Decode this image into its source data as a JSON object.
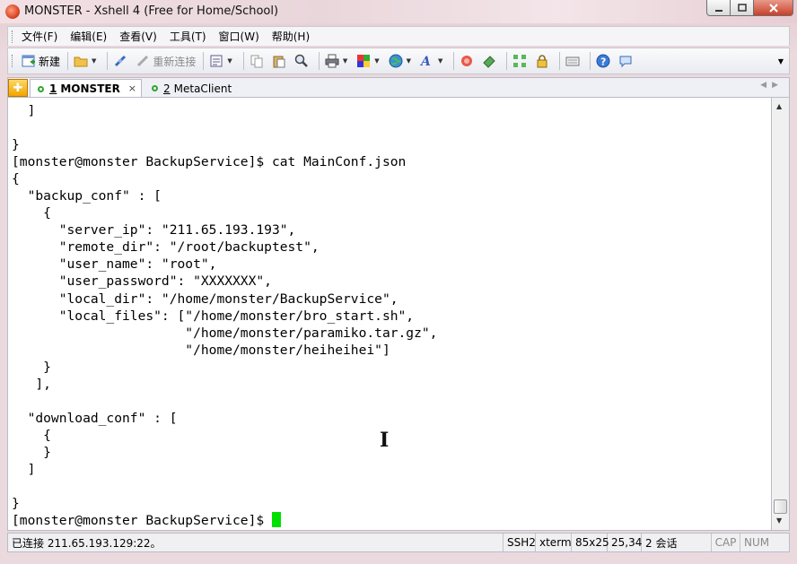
{
  "window": {
    "title": "MONSTER - Xshell 4 (Free for Home/School)"
  },
  "menu": {
    "items": [
      "文件(F)",
      "编辑(E)",
      "查看(V)",
      "工具(T)",
      "窗口(W)",
      "帮助(H)"
    ]
  },
  "toolbar": {
    "new_label": "新建",
    "reconnect_label": "重新连接"
  },
  "tabs": [
    {
      "number": "1",
      "label": "MONSTER",
      "active": true
    },
    {
      "number": "2",
      "label": "MetaClient",
      "active": false
    }
  ],
  "terminal": {
    "lines": [
      "  ]",
      "",
      "}",
      "[monster@monster BackupService]$ cat MainConf.json",
      "{",
      "  \"backup_conf\" : [",
      "    {",
      "      \"server_ip\": \"211.65.193.193\",",
      "      \"remote_dir\": \"/root/backuptest\",",
      "      \"user_name\": \"root\",",
      "      \"user_password\": \"XXXXXXX\",",
      "      \"local_dir\": \"/home/monster/BackupService\",",
      "      \"local_files\": [\"/home/monster/bro_start.sh\",",
      "                      \"/home/monster/paramiko.tar.gz\",",
      "                      \"/home/monster/heiheihei\"]",
      "    }",
      "   ],",
      "",
      "  \"download_conf\" : [",
      "    {",
      "    }",
      "  ]",
      "",
      "}"
    ],
    "prompt": "[monster@monster BackupService]$ "
  },
  "status": {
    "connection": "已连接 211.65.193.129:22。",
    "protocol": "SSH2",
    "term_type": "xterm",
    "size": "85x25",
    "cursor_pos": "25,34",
    "sessions": "2 会话",
    "caps": "CAP",
    "num": "NUM"
  },
  "colors": {
    "cursor": "#00e000",
    "tab_dot": "#2fa52f"
  }
}
